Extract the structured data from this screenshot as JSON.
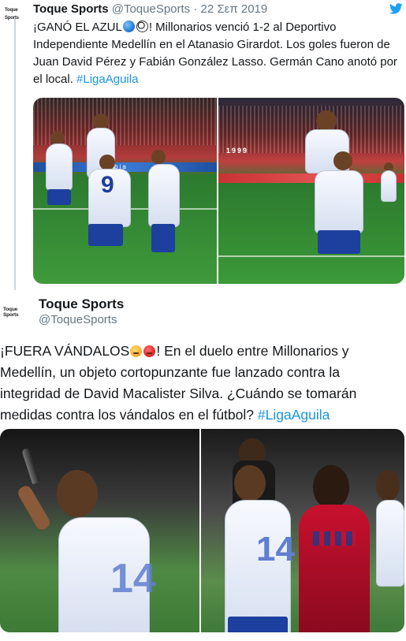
{
  "reply_context": {
    "avatar_text": "Toque Sports",
    "name": "Toque Sports",
    "handle": "@ToqueSports",
    "separator": "·",
    "date": "22 Σεπ 2019",
    "text_part1": "¡GANÓ EL AZUL",
    "text_part2": "! Millonarios venció 1-2 al Deportivo Independiente Medellín en el Atanasio Girardot. Los goles fueron de Juan David Pérez y Fabián González Lasso. Germán Cano anotó por el local.",
    "hashtag": "#LigaAguila",
    "emojis": [
      "blue-circle",
      "soccer-ball"
    ],
    "media": {
      "photo_left": {
        "jersey_number": "9",
        "board_text": "Colombia"
      },
      "photo_right": {
        "banner_text": "1999"
      }
    }
  },
  "tweet": {
    "avatar_text": "Toque Sports",
    "name": "Toque Sports",
    "handle": "@ToqueSports",
    "text_part1": "¡FUERA VÁNDALOS",
    "text_part2": "! En el duelo entre Millonarios y Medellín, un objeto cortopunzante fue lanzado contra la integridad de David Macalister Silva. ¿Cuándo se tomarán medidas contra los vándalos en el fútbol?",
    "hashtag": "#LigaAguila",
    "emojis": [
      "angry-face",
      "pouting-face"
    ],
    "media": {
      "photo_left": {
        "jersey_number": "14"
      },
      "photo_right": {
        "jersey_number": "14"
      }
    }
  },
  "colors": {
    "link": "#1b95e0",
    "secondary_text": "#657786",
    "thread_line": "#ccd6dd",
    "twitter_blue": "#1da1f2"
  }
}
